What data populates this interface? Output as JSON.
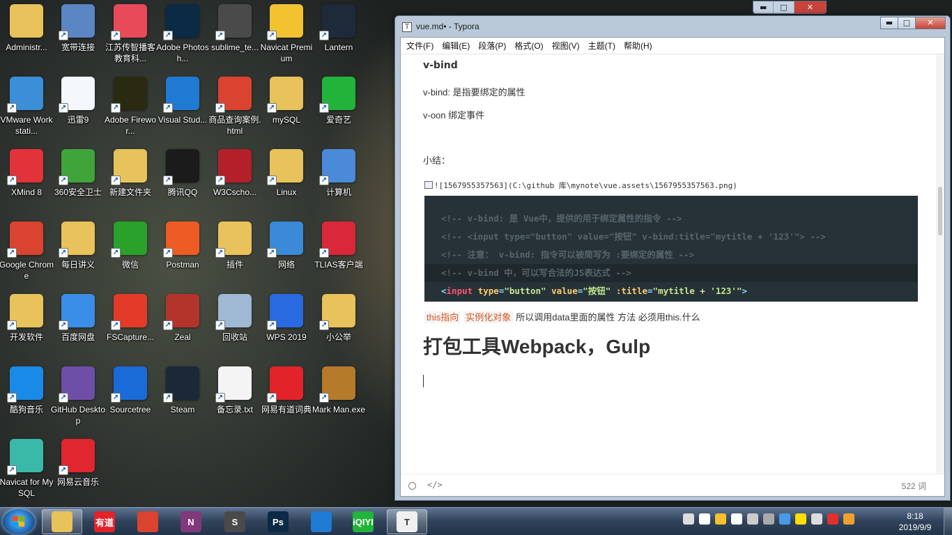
{
  "desktop": {
    "icons": [
      {
        "label": "Administr...",
        "icon": "user-folder-icon",
        "color": "#e8c25a"
      },
      {
        "label": "宽带连接",
        "icon": "network-connection-icon",
        "color": "#5a86c4"
      },
      {
        "label": "江苏传智播客教育科...",
        "icon": "video-player-icon",
        "color": "#e94a5a"
      },
      {
        "label": "Adobe Photosh...",
        "icon": "photoshop-icon",
        "color": "#0a2a45"
      },
      {
        "label": "sublime_te...",
        "icon": "sublime-text-icon",
        "color": "#4a4a4a"
      },
      {
        "label": "Navicat Premium",
        "icon": "navicat-icon",
        "color": "#f2c230"
      },
      {
        "label": "Lantern",
        "icon": "lantern-icon",
        "color": "#1e2a3a"
      },
      {
        "label": "VMware Workstati...",
        "icon": "vmware-icon",
        "color": "#3a8fd8"
      },
      {
        "label": "迅雷9",
        "icon": "thunder-icon",
        "color": "#f4f7fb"
      },
      {
        "label": "Adobe Firewor...",
        "icon": "fireworks-icon",
        "color": "#2a2a10"
      },
      {
        "label": "Visual Stud...",
        "icon": "vscode-icon",
        "color": "#1f7ad4"
      },
      {
        "label": "商品查询案例.html",
        "icon": "chrome-icon",
        "color": "#d9432f"
      },
      {
        "label": "mySQL",
        "icon": "folder-icon",
        "color": "#e8c25a"
      },
      {
        "label": "爱奇艺",
        "icon": "iqiyi-icon",
        "color": "#22b43a"
      },
      {
        "label": "XMind 8",
        "icon": "xmind-icon",
        "color": "#e2323a"
      },
      {
        "label": "360安全卫士",
        "icon": "security-360-icon",
        "color": "#3fa43a"
      },
      {
        "label": "新建文件夹",
        "icon": "folder-icon",
        "color": "#e8c25a"
      },
      {
        "label": "腾讯QQ",
        "icon": "qq-icon",
        "color": "#1b1b1b"
      },
      {
        "label": "W3Cscho...",
        "icon": "w3cschool-icon",
        "color": "#b3202a"
      },
      {
        "label": "Linux",
        "icon": "folder-icon",
        "color": "#e8c25a"
      },
      {
        "label": "计算机",
        "icon": "computer-icon",
        "color": "#4a8ad8"
      },
      {
        "label": "Google Chrome",
        "icon": "chrome-icon",
        "color": "#d9432f"
      },
      {
        "label": "每日讲义",
        "icon": "folder-icon",
        "color": "#e8c25a"
      },
      {
        "label": "微信",
        "icon": "wechat-icon",
        "color": "#2aa12a"
      },
      {
        "label": "Postman",
        "icon": "postman-icon",
        "color": "#ef5b25"
      },
      {
        "label": "插件",
        "icon": "folder-icon",
        "color": "#e8c25a"
      },
      {
        "label": "网络",
        "icon": "network-globe-icon",
        "color": "#3a8ad8"
      },
      {
        "label": "TLIAS客户端",
        "icon": "tlias-icon",
        "color": "#d8283a"
      },
      {
        "label": "开发软件",
        "icon": "folder-icon",
        "color": "#e8c25a"
      },
      {
        "label": "百度网盘",
        "icon": "baidu-netdisk-icon",
        "color": "#3a8ee8"
      },
      {
        "label": "FSCapture...",
        "icon": "fscapture-icon",
        "color": "#e43a2a"
      },
      {
        "label": "Zeal",
        "icon": "zeal-icon",
        "color": "#b3342a"
      },
      {
        "label": "回收站",
        "icon": "recycle-bin-icon",
        "color": "#9fb8d4"
      },
      {
        "label": "WPS 2019",
        "icon": "wps-icon",
        "color": "#2a6ae0"
      },
      {
        "label": "小公举",
        "icon": "folder-icon",
        "color": "#e8c25a"
      },
      {
        "label": "酷狗音乐",
        "icon": "kugou-icon",
        "color": "#1a8ae8"
      },
      {
        "label": "GitHub Desktop",
        "icon": "github-desktop-icon",
        "color": "#6e4fa8"
      },
      {
        "label": "Sourcetree",
        "icon": "sourcetree-icon",
        "color": "#1a6ad8"
      },
      {
        "label": "Steam",
        "icon": "steam-icon",
        "color": "#1b2838"
      },
      {
        "label": "备忘录.txt",
        "icon": "text-file-icon",
        "color": "#f4f4f4"
      },
      {
        "label": "网易有道词典",
        "icon": "youdao-icon",
        "color": "#e2232a"
      },
      {
        "label": "Mark Man.exe",
        "icon": "markman-icon",
        "color": "#b57a2a"
      },
      {
        "label": "Navicat for MySQL",
        "icon": "navicat-mysql-icon",
        "color": "#3ab8a8"
      },
      {
        "label": "网易云音乐",
        "icon": "netease-music-icon",
        "color": "#e0262e"
      }
    ]
  },
  "ghost_window": {
    "min": "▬",
    "max": "□",
    "close": "✕"
  },
  "window": {
    "app_icon": "T",
    "title": "vue.md• - Typora",
    "controls": {
      "min": "▬",
      "max": "□",
      "close": "✕"
    },
    "menu": [
      "文件(F)",
      "编辑(E)",
      "段落(P)",
      "格式(O)",
      "视图(V)",
      "主题(T)",
      "帮助(H)"
    ]
  },
  "document": {
    "heading4": "v-bind",
    "para1": "v-bind: 是指要绑定的属性",
    "para2": "v-oon  绑定事件",
    "para3": "小结：",
    "image_markdown": "![1567955357563](C:\\github 库\\mynote\\vue.assets\\1567955357563.png)",
    "code_lines": [
      "<!-- v-bind: 是 Vue中，提供的用于绑定属性的指令 -->",
      "<!-- <input type=\"button\" value=\"按钮\" v-bind:title=\"mytitle + '123'\"> -->",
      "<!-- 注意： v-bind: 指令可以被简写为 :要绑定的属性 -->",
      "<!-- v-bind 中，可以写合法的JS表达式 -->"
    ],
    "code_last": {
      "open": "<",
      "tag": "input",
      "attr1": "type",
      "val1": "\"button\"",
      "attr2": "value",
      "val2": "\"按钮\"",
      "attr3": ":title",
      "val3": "\"mytitle + '123'\"",
      "close": ">"
    },
    "inline_code1": "this指向",
    "inline_code2": "实例化对象",
    "inline_text": "所以调用data里面的属性 方法 必须用this.什么",
    "heading1": "打包工具Webpack，Gulp"
  },
  "status": {
    "source_toggle": "</>",
    "word_count": "522 词"
  },
  "taskbar": {
    "apps": [
      {
        "name": "explorer",
        "icon": "file-explorer-icon",
        "color": "#e8c25a",
        "text": ""
      },
      {
        "name": "youdao",
        "icon": "youdao-icon",
        "color": "#e2232a",
        "text": "有道"
      },
      {
        "name": "chrome",
        "icon": "chrome-icon",
        "color": "#d9432f",
        "text": ""
      },
      {
        "name": "onenote",
        "icon": "onenote-icon",
        "color": "#80397b",
        "text": "N"
      },
      {
        "name": "sublime",
        "icon": "sublime-text-icon",
        "color": "#4a4a4a",
        "text": "S"
      },
      {
        "name": "photoshop",
        "icon": "photoshop-icon",
        "color": "#0a2a45",
        "text": "Ps"
      },
      {
        "name": "vscode",
        "icon": "vscode-icon",
        "color": "#1f7ad4",
        "text": ""
      },
      {
        "name": "iqiyi",
        "icon": "iqiyi-icon",
        "color": "#22b43a",
        "text": "iQIYI"
      },
      {
        "name": "typora",
        "icon": "typora-icon",
        "color": "#f0f0f0",
        "text": "T"
      }
    ],
    "tray_colors": [
      "#dddddd",
      "#ffffff",
      "#f4c030",
      "#ffffff",
      "#cccccc",
      "#aaaaaa",
      "#4a9ae8",
      "#ffdd00",
      "#dddddd",
      "#e03030",
      "#f0a030"
    ],
    "time": "8:18",
    "date": "2019/9/9"
  }
}
